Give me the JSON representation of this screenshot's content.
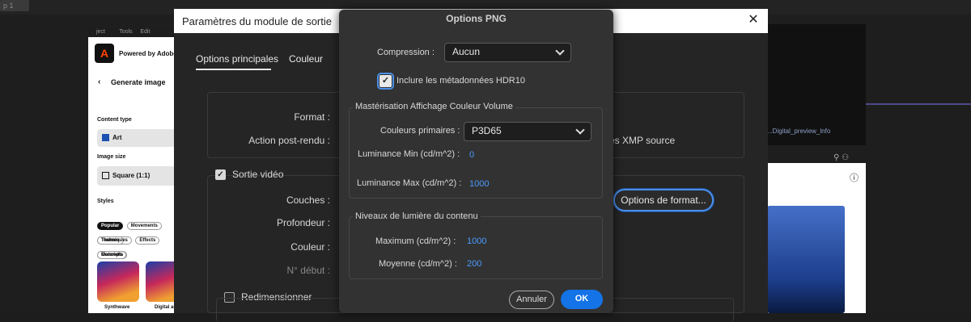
{
  "background": {
    "tab": "p 1",
    "right_file_text": "...Digital_preview_lnfo",
    "menu_items": [
      "ject",
      "Tools",
      "Edit"
    ]
  },
  "side_panel": {
    "powered_by": "Powered by Adobe",
    "back_title": "Generate image",
    "content_type_label": "Content type",
    "content_type_value": "Art",
    "image_size_label": "Image size",
    "image_size_value": "Square (1:1)",
    "styles_label": "Styles",
    "style_pills_row1": [
      "Popular",
      "Movements",
      "Themes"
    ],
    "style_pills_row2": [
      "Techniques",
      "Effects",
      "Materials"
    ],
    "style_pills_row3": [
      "Concepts"
    ],
    "thumbs": [
      "Synthwave",
      "Digital art"
    ]
  },
  "main_dialog": {
    "title": "Paramètres du module de sortie",
    "tabs": [
      "Options principales",
      "Couleur"
    ],
    "format_label": "Format :",
    "post_render_label": "Action post-rendu :",
    "xmp_text": "es XMP source",
    "video_output_label": "Sortie vidéo",
    "couches_label": "Couches :",
    "profondeur_label": "Profondeur :",
    "couleur_label": "Couleur :",
    "debut_label": "N° début :",
    "format_options_button": "Options de format...",
    "resize_label": "Redimensionner"
  },
  "png_dialog": {
    "title": "Options PNG",
    "compression_label": "Compression :",
    "compression_value": "Aucun",
    "include_hdr10_label": "Inclure les métadonnées HDR10",
    "mastering_group_title": "Mastérisation Affichage Couleur Volume",
    "primaries_label": "Couleurs primaires :",
    "primaries_value": "P3D65",
    "lum_min_label": "Luminance Min (cd/m^2) :",
    "lum_min_value": "0",
    "lum_max_label": "Luminance Max (cd/m^2) :",
    "lum_max_value": "1000",
    "content_light_group_title": "Niveaux de lumière du contenu",
    "maximum_label": "Maximum (cd/m^2) :",
    "maximum_value": "1000",
    "average_label": "Moyenne (cd/m^2) :",
    "average_value": "200",
    "cancel_button": "Annuler",
    "ok_button": "OK"
  },
  "colors": {
    "accent": "#1473e6",
    "focus_ring": "#4b8fe8",
    "value_blue": "#4b9bff"
  }
}
